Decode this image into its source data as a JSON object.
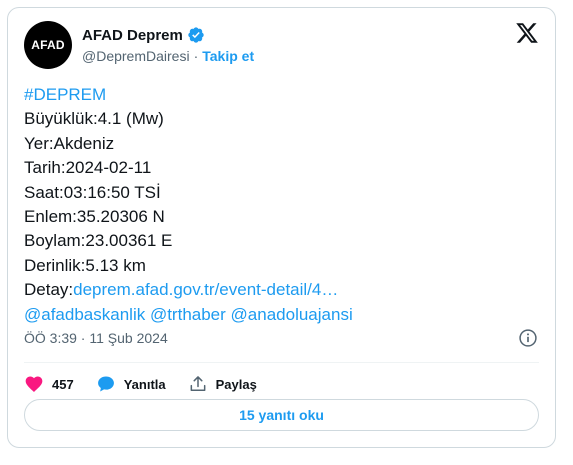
{
  "author": {
    "avatar_text": "AFAD",
    "display_name": "AFAD Deprem",
    "handle": "@DepremDairesi",
    "separator": "·",
    "follow_label": "Takip et"
  },
  "tweet": {
    "hashtag": "#DEPREM",
    "magnitude": "Büyüklük:4.1 (Mw)",
    "location": "Yer:Akdeniz",
    "date": "Tarih:2024-02-11",
    "time": "Saat:03:16:50 TSİ",
    "latitude": "Enlem:35.20306 N",
    "longitude": "Boylam:23.00361 E",
    "depth": "Derinlik:5.13 km",
    "detail_prefix": "Detay:",
    "detail_link": "deprem.afad.gov.tr/event-detail/4…",
    "mentions": [
      "@afadbaskanlik",
      "@trthaber",
      "@anadoluajansi"
    ],
    "timestamp": "ÖÖ 3:39 · 11 Şub 2024"
  },
  "actions": {
    "like_count": "457",
    "reply_label": "Yanıtla",
    "share_label": "Paylaş"
  },
  "replies_button": "15 yanıtı oku",
  "colors": {
    "accent": "#1d9bf0",
    "like": "#f91880",
    "text": "#0f1419",
    "muted": "#536471"
  }
}
